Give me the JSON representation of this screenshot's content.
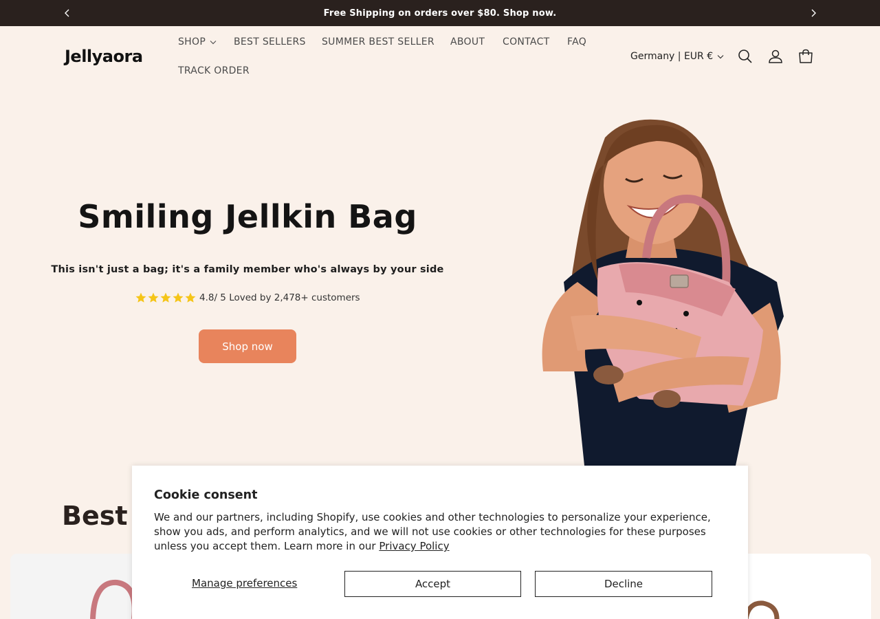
{
  "announcement": {
    "text": "Free Shipping on orders over $80. Shop now.",
    "prev_icon": "chevron-left-icon",
    "next_icon": "chevron-right-icon"
  },
  "header": {
    "logo": "Jellyaora",
    "nav": [
      {
        "label": "SHOP",
        "has_dropdown": true
      },
      {
        "label": "BEST SELLERS"
      },
      {
        "label": "SUMMER BEST SELLER"
      },
      {
        "label": "ABOUT"
      },
      {
        "label": "CONTACT"
      },
      {
        "label": "FAQ"
      },
      {
        "label": "TRACK ORDER"
      }
    ],
    "locale": "Germany | EUR €",
    "icons": [
      "search-icon",
      "account-icon",
      "cart-icon"
    ]
  },
  "hero": {
    "title": "Smiling Jellkin Bag",
    "subtitle": "This isn't just a bag; it's a family member who's always by your side",
    "rating_text": "4.8/ 5 Loved by 2,478+ customers",
    "rating_stars": 5,
    "button_label": "Shop now"
  },
  "best_sellers": {
    "heading_visible": "Best"
  },
  "cookie": {
    "title": "Cookie consent",
    "body": "We and our partners, including Shopify, use cookies and other technologies to personalize your experience, show you ads, and perform analytics, and we will not use cookies or other technologies for these purposes unless you accept them. Learn more in our ",
    "link_text": "Privacy Policy",
    "manage_label": "Manage preferences",
    "accept_label": "Accept",
    "decline_label": "Decline"
  },
  "colors": {
    "background": "#faf1ea",
    "announcement_bg": "#2a211e",
    "accent": "#e8845c",
    "star": "#f5c518"
  }
}
